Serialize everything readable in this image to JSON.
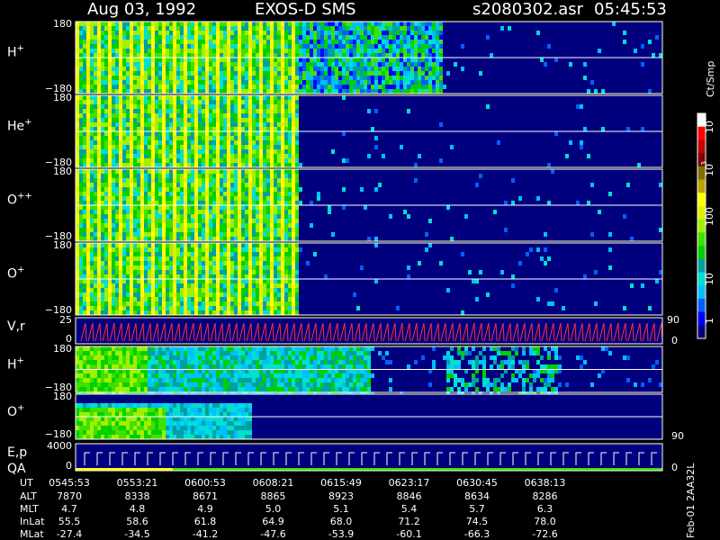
{
  "header": {
    "date": "Aug 03, 1992",
    "instrument": "EXOS-D SMS",
    "file": "s2080302.asr",
    "time": "05:45:53"
  },
  "colorbar": {
    "unit_label": "Ct/Smp",
    "tick_labels": [
      "1",
      "10",
      "100",
      "10",
      "10",
      "3",
      "4"
    ],
    "colors": [
      "#00007f",
      "#0000ff",
      "#0060ff",
      "#00c0ff",
      "#00e0d0",
      "#00a0a0",
      "#00d000",
      "#40e000",
      "#a0f000",
      "#e0f000",
      "#ffff00",
      "#c0a000",
      "#807000",
      "#800000",
      "#c00000",
      "#ff0000",
      "#ffffff"
    ]
  },
  "side_note": "Feb-01 2AA32L",
  "footer": {
    "row_labels": [
      "UT",
      "ALT",
      "MLT",
      "InLat",
      "MLat"
    ],
    "columns": [
      [
        "0545:53",
        "7870",
        "4.7",
        "55.5",
        "-27.4"
      ],
      [
        "0553:21",
        "8338",
        "4.8",
        "58.6",
        "-34.5"
      ],
      [
        "0600:53",
        "8671",
        "4.9",
        "61.8",
        "-41.2"
      ],
      [
        "0608:21",
        "8865",
        "5.0",
        "64.9",
        "-47.6"
      ],
      [
        "0615:49",
        "8923",
        "5.1",
        "68.0",
        "-53.9"
      ],
      [
        "0623:17",
        "8846",
        "5.4",
        "71.2",
        "-60.1"
      ],
      [
        "0630:45",
        "8634",
        "5.7",
        "74.5",
        "-66.3"
      ],
      [
        "0638:13",
        "8286",
        "6.3",
        "78.0",
        "-72.6"
      ]
    ]
  },
  "chart_data": {
    "type": "heatmap",
    "x_tick_count": 8,
    "panels": [
      {
        "label": "H",
        "sup": "+",
        "ymax": "180",
        "ymin": "−180",
        "right": ""
      },
      {
        "label": "He",
        "sup": "+",
        "ymax": "180",
        "ymin": "−180",
        "right": ""
      },
      {
        "label": "O",
        "sup": "++",
        "ymax": "180",
        "ymin": "−180",
        "right": ""
      },
      {
        "label": "O",
        "sup": "+",
        "ymax": "180",
        "ymin": "−180",
        "right": ""
      },
      {
        "label": "V,r",
        "sup": "",
        "ymax": "25",
        "ymin": "0",
        "right_top": "90",
        "right_bottom": "0"
      },
      {
        "label": "H",
        "sup": "+",
        "ymax": "180",
        "ymin": "−180",
        "right": ""
      },
      {
        "label": "O",
        "sup": "+",
        "ymax": "180",
        "ymin": "−180",
        "right_bottom": "90"
      },
      {
        "label": "E,p",
        "sup": "",
        "label2": "QA",
        "ymax": "4000",
        "ymin": "0",
        "right_bottom": "0"
      }
    ]
  }
}
